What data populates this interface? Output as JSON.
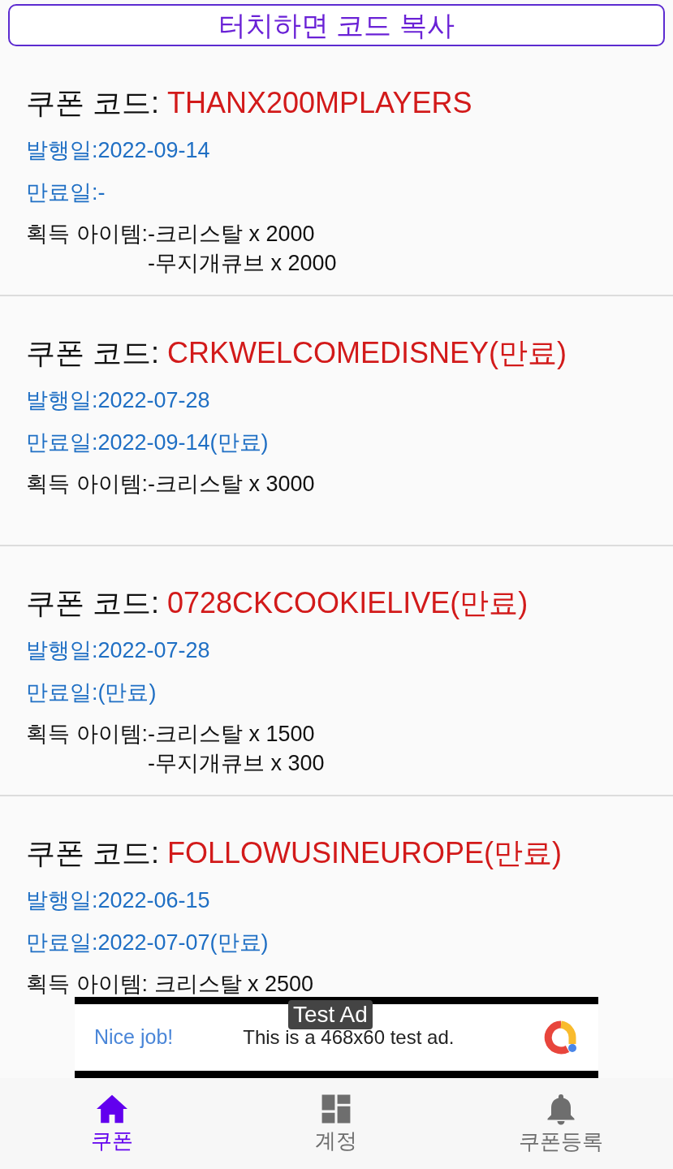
{
  "header_button": "터치하면 코드 복사",
  "coupons": [
    {
      "code_label": "쿠폰 코드: ",
      "code": "THANX200MPLAYERS",
      "issued": "발행일:2022-09-14",
      "expires": "만료일:-",
      "items_label": "획득 아이템:",
      "items": [
        "-크리스탈 x 2000",
        "-무지개큐브 x 2000"
      ]
    },
    {
      "code_label": "쿠폰 코드: ",
      "code": "CRKWELCOMEDISNEY(만료)",
      "issued": "발행일:2022-07-28",
      "expires": "만료일:2022-09-14(만료)",
      "items_label": "획득 아이템:",
      "items": [
        "-크리스탈 x 3000"
      ]
    },
    {
      "code_label": "쿠폰 코드: ",
      "code": "0728CKCOOKIELIVE(만료)",
      "issued": "발행일:2022-07-28",
      "expires": "만료일:(만료)",
      "items_label": "획득 아이템:",
      "items": [
        "-크리스탈 x 1500",
        "-무지개큐브 x 300"
      ]
    },
    {
      "code_label": "쿠폰 코드: ",
      "code": "FOLLOWUSINEUROPE(만료)",
      "issued": "발행일:2022-06-15",
      "expires": "만료일:2022-07-07(만료)",
      "items_label": "획득 아이템:",
      "items": [
        " 크리스탈 x 2500"
      ]
    }
  ],
  "ad": {
    "badge": "Test Ad",
    "headline": "Nice job!",
    "text": "This is a 468x60 test ad."
  },
  "bottom_nav": [
    {
      "kind": "home",
      "label": "쿠폰",
      "selected": true
    },
    {
      "kind": "dashboard",
      "label": "계정",
      "selected": false
    },
    {
      "kind": "bell",
      "label": "쿠폰등록",
      "selected": false
    }
  ]
}
